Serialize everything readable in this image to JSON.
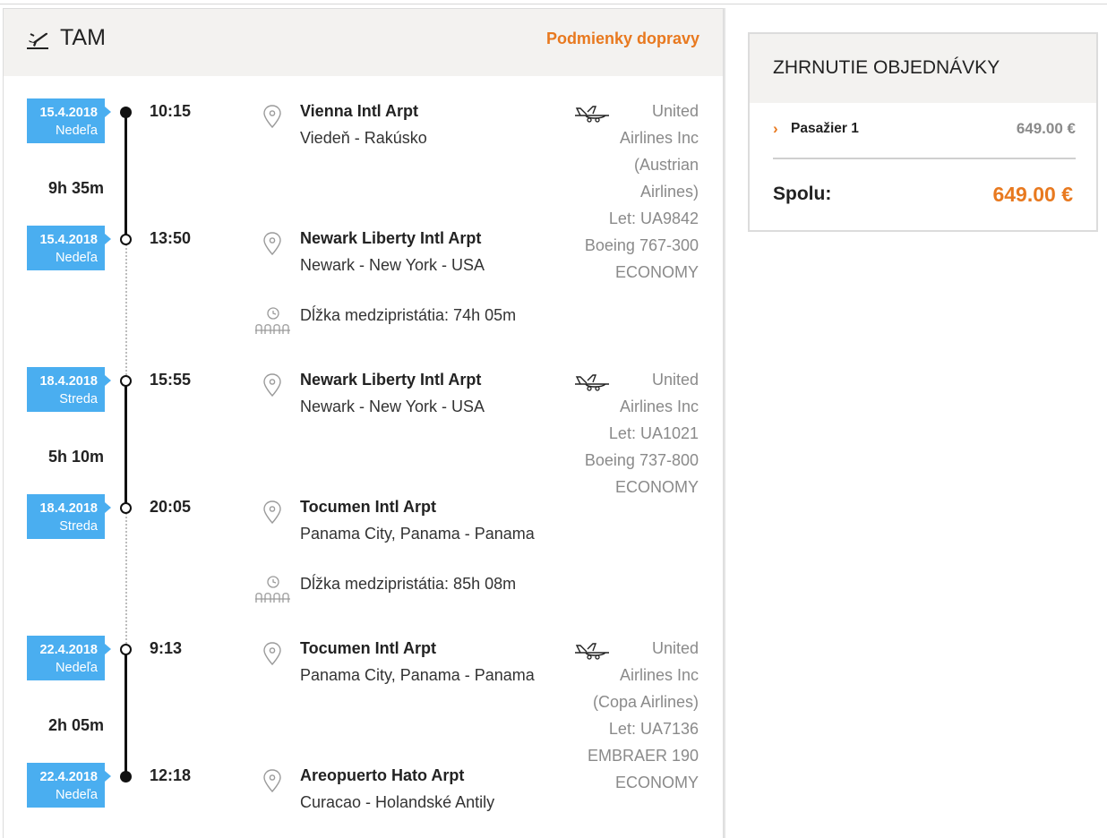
{
  "header": {
    "title": "TAM",
    "conditions_link": "Podmienky dopravy"
  },
  "legs": [
    {
      "departure": {
        "date": "15.4.2018",
        "weekday": "Nedeľa",
        "time": "10:15",
        "airport": "Vienna Intl Arpt",
        "city": "Viedeň - Rakúsko"
      },
      "duration": "9h 35m",
      "arrival": {
        "date": "15.4.2018",
        "weekday": "Nedeľa",
        "time": "13:50",
        "airport": "Newark Liberty Intl Arpt",
        "city": "Newark - New York - USA"
      },
      "flight_lines": [
        "United",
        "Airlines Inc",
        "(Austrian",
        "Airlines)",
        "Let: UA9842",
        "Boeing 767-300",
        "ECONOMY"
      ]
    },
    {
      "departure": {
        "date": "18.4.2018",
        "weekday": "Streda",
        "time": "15:55",
        "airport": "Newark Liberty Intl Arpt",
        "city": "Newark - New York - USA"
      },
      "duration": "5h 10m",
      "arrival": {
        "date": "18.4.2018",
        "weekday": "Streda",
        "time": "20:05",
        "airport": "Tocumen Intl Arpt",
        "city": "Panama City, Panama - Panama"
      },
      "flight_lines": [
        "United",
        "Airlines Inc",
        "Let: UA1021",
        "Boeing 737-800",
        "ECONOMY"
      ]
    },
    {
      "departure": {
        "date": "22.4.2018",
        "weekday": "Nedeľa",
        "time": "9:13",
        "airport": "Tocumen Intl Arpt",
        "city": "Panama City, Panama - Panama"
      },
      "duration": "2h 05m",
      "arrival": {
        "date": "22.4.2018",
        "weekday": "Nedeľa",
        "time": "12:18",
        "airport": "Areopuerto Hato Arpt",
        "city": "Curacao - Holandské Antily"
      },
      "flight_lines": [
        "United",
        "Airlines Inc",
        "(Copa Airlines)",
        "Let: UA7136",
        "EMBRAER 190",
        "ECONOMY"
      ]
    }
  ],
  "layovers": [
    {
      "label": "Dĺžka medzipristátia: 74h 05m"
    },
    {
      "label": "Dĺžka medzipristátia: 85h 08m"
    }
  ],
  "summary": {
    "title": "ZHRNUTIE OBJEDNÁVKY",
    "passenger_label": "Pasažier 1",
    "passenger_price": "649.00 €",
    "total_label": "Spolu:",
    "total_value": "649.00 €"
  },
  "colors": {
    "accent": "#e8791f",
    "badge": "#4aaef0",
    "header_bg": "#f3f2f0"
  }
}
